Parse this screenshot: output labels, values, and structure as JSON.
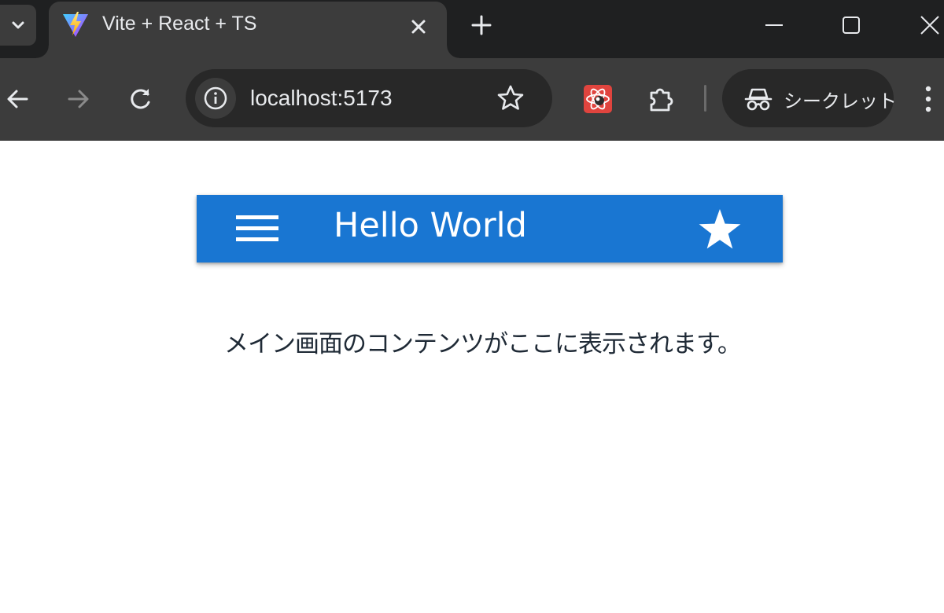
{
  "browser": {
    "tab": {
      "title": "Vite + React + TS",
      "favicon": "vite-logo"
    },
    "address_bar": {
      "url": "localhost:5173"
    },
    "profile": {
      "label": "シークレット",
      "icon": "incognito-icon"
    },
    "icons": [
      "tab-search-icon",
      "close-icon",
      "plus-icon",
      "minimize-icon",
      "maximize-icon",
      "back-arrow-icon",
      "forward-arrow-icon",
      "reload-icon",
      "info-icon",
      "star-outline-icon",
      "react-devtools-icon",
      "puzzle-icon",
      "kebab-menu-icon"
    ]
  },
  "app": {
    "title": "Hello World",
    "colors": {
      "app_bar": "#1976d2",
      "text_on_bar": "#ffffff"
    },
    "icons": {
      "menu": "hamburger-icon",
      "favorite": "star-icon"
    }
  },
  "main": {
    "text": "メイン画面のコンテンツがここに表示されます。"
  }
}
